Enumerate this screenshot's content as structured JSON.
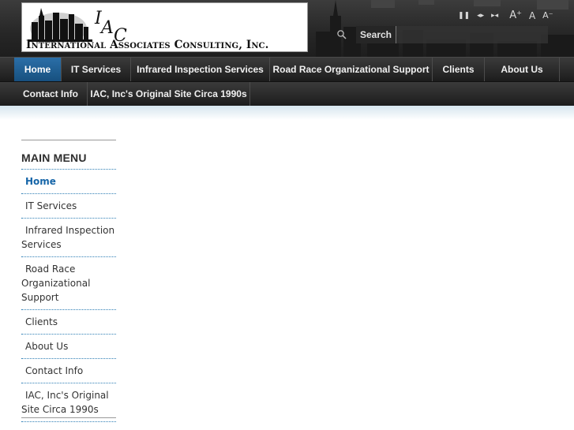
{
  "site": {
    "logo_text": "International Associates Consulting, Inc.",
    "logo_initials": "IAC"
  },
  "tools": {
    "items": [
      {
        "glyph": "❚❚",
        "icon": "pause-icon"
      },
      {
        "glyph": "◂▸",
        "icon": "widen-icon"
      },
      {
        "glyph": "▸◂",
        "icon": "narrow-icon"
      },
      {
        "glyph": "A⁺",
        "icon": "font-increase-icon"
      },
      {
        "glyph": "A",
        "icon": "font-reset-icon"
      },
      {
        "glyph": "A⁻",
        "icon": "font-decrease-icon"
      }
    ]
  },
  "search": {
    "button_label": "Search",
    "value": "",
    "placeholder": ""
  },
  "nav": {
    "row1": [
      "Home",
      "IT Services",
      "Infrared Inspection Services",
      "Road Race Organizational Support",
      "Clients",
      "About Us"
    ],
    "row2": [
      "Contact Info",
      "IAC, Inc's Original Site Circa 1990s"
    ],
    "active": "Home"
  },
  "sidebar": {
    "title": "MAIN MENU",
    "items": [
      {
        "label": "Home",
        "active": true
      },
      {
        "label": "IT Services",
        "active": false
      },
      {
        "label": "Infrared Inspection Services",
        "active": false
      },
      {
        "label": "Road Race Organizational Support",
        "active": false
      },
      {
        "label": "Clients",
        "active": false
      },
      {
        "label": "About Us",
        "active": false
      },
      {
        "label": "Contact Info",
        "active": false
      },
      {
        "label": "IAC, Inc's Original Site Circa 1990s",
        "active": false
      }
    ]
  },
  "colors": {
    "accent": "#1565a8",
    "nav_active": "#2b6fa8",
    "header_bg": "#2a2a2a"
  }
}
